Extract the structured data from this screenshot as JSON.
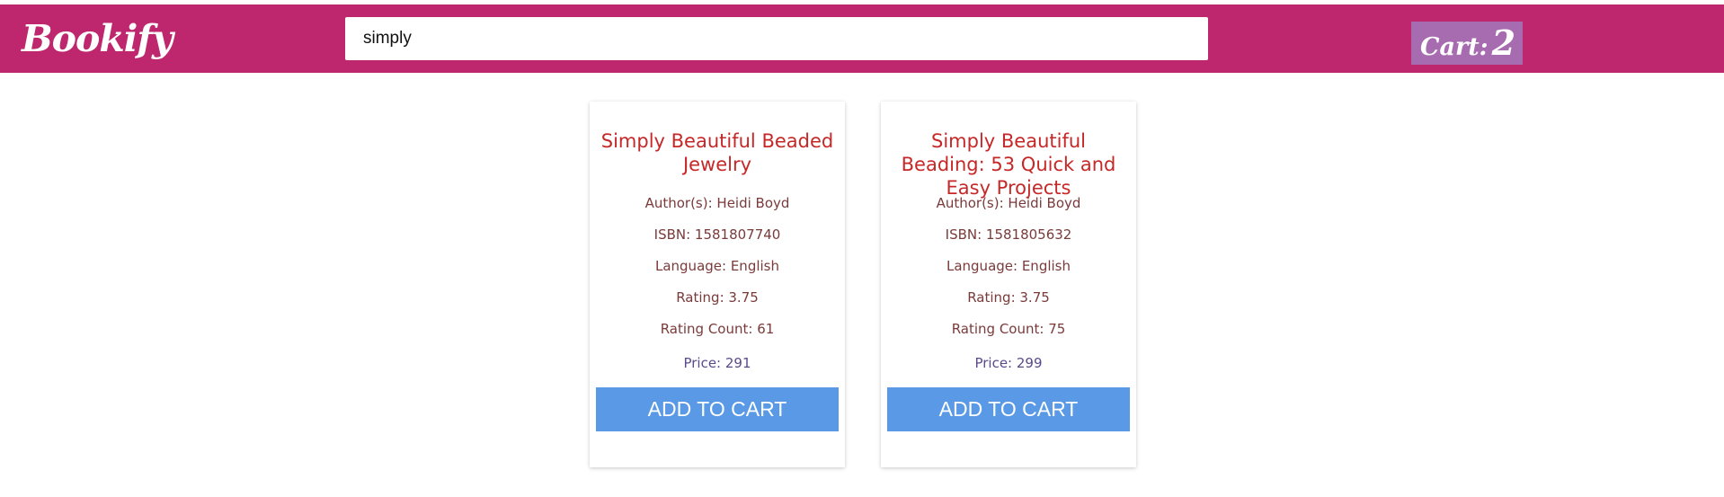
{
  "header": {
    "logo": "Bookify",
    "search_value": "simply",
    "cart_label": "Cart:",
    "cart_count": "2",
    "bar_color": "#be266d",
    "cart_color": "#a76bb0"
  },
  "books": [
    {
      "title": "Simply Beautiful Beaded Jewelry",
      "author": "Author(s): Heidi Boyd",
      "isbn": "ISBN: 1581807740",
      "language": "Language: English",
      "rating": "Rating: 3.75",
      "rating_count": "Rating Count: 61",
      "price": "Price: 291",
      "button": "ADD TO CART"
    },
    {
      "title": "Simply Beautiful Beading: 53 Quick and Easy Projects",
      "author": "Author(s): Heidi Boyd",
      "isbn": "ISBN: 1581805632",
      "language": "Language: English",
      "rating": "Rating: 3.75",
      "rating_count": "Rating Count: 75",
      "price": "Price: 299",
      "button": "ADD TO CART"
    }
  ],
  "colors": {
    "title": "#c62828",
    "button": "#5999e6"
  }
}
